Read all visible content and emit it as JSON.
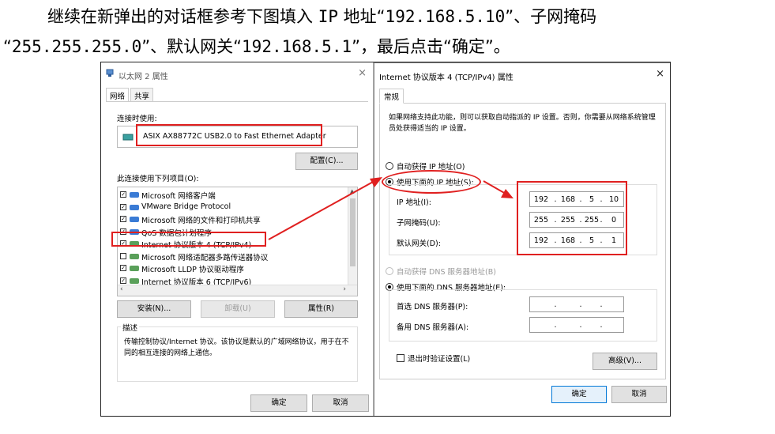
{
  "instruction": {
    "line1_parts": [
      "继续在新弹出的对话框参考下图填入 ",
      "IP",
      " 地址“",
      "192.168.5.10",
      "”、子网掩码"
    ],
    "line2_parts": [
      "“",
      "255.255.255.0",
      "”、默认网关“",
      "192.168.5.1",
      "”，最后点击“确定”。"
    ]
  },
  "left_dialog": {
    "title": "以太网 2 属性",
    "tabs": [
      "网络",
      "共享"
    ],
    "connect_using_label": "连接时使用:",
    "adapter_name": "ASIX AX88772C USB2.0 to Fast Ethernet Adapter",
    "configure_button": "配置(C)...",
    "items_label": "此连接使用下列项目(O):",
    "items": [
      {
        "label": "Microsoft 网络客户端",
        "checked": true
      },
      {
        "label": "VMware Bridge Protocol",
        "checked": true
      },
      {
        "label": "Microsoft 网络的文件和打印机共享",
        "checked": true
      },
      {
        "label": "QoS 数据包计划程序",
        "checked": true
      },
      {
        "label": "Internet 协议版本 4 (TCP/IPv4)",
        "checked": true
      },
      {
        "label": "Microsoft 网络适配器多路传送器协议",
        "checked": false
      },
      {
        "label": "Microsoft LLDP 协议驱动程序",
        "checked": true
      },
      {
        "label": "Internet 协议版本 6 (TCP/IPv6)",
        "checked": true
      }
    ],
    "install_button": "安装(N)...",
    "uninstall_button": "卸载(U)",
    "properties_button": "属性(R)",
    "description_title": "描述",
    "description_text": "传输控制协议/Internet 协议。该协议是默认的广域网络协议，用于在不同的相互连接的网络上通信。",
    "ok_button": "确定",
    "cancel_button": "取消"
  },
  "right_dialog": {
    "title": "Internet 协议版本 4 (TCP/IPv4) 属性",
    "close_glyph": "×",
    "tab": "常规",
    "intro": "如果网络支持此功能，则可以获取自动指派的 IP 设置。否则，你需要从网络系统管理员处获得适当的 IP 设置。",
    "auto_ip_label": "自动获得 IP 地址(O)",
    "manual_ip_label": "使用下面的 IP 地址(S):",
    "ip_label": "IP 地址(I):",
    "ip_value": [
      "192",
      "168",
      "5",
      "10"
    ],
    "mask_label": "子网掩码(U):",
    "mask_value": [
      "255",
      "255",
      "255",
      "0"
    ],
    "gateway_label": "默认网关(D):",
    "gateway_value": [
      "192",
      "168",
      "5",
      "1"
    ],
    "auto_dns_label": "自动获得 DNS 服务器地址(B)",
    "manual_dns_label": "使用下面的 DNS 服务器地址(E):",
    "preferred_dns_label": "首选 DNS 服务器(P):",
    "alternate_dns_label": "备用 DNS 服务器(A):",
    "validate_label": "退出时验证设置(L)",
    "advanced_button": "高级(V)...",
    "ok_button": "确定",
    "cancel_button": "取消"
  },
  "colors": {
    "annotation_red": "#e02020",
    "accent_blue": "#0078d7"
  }
}
